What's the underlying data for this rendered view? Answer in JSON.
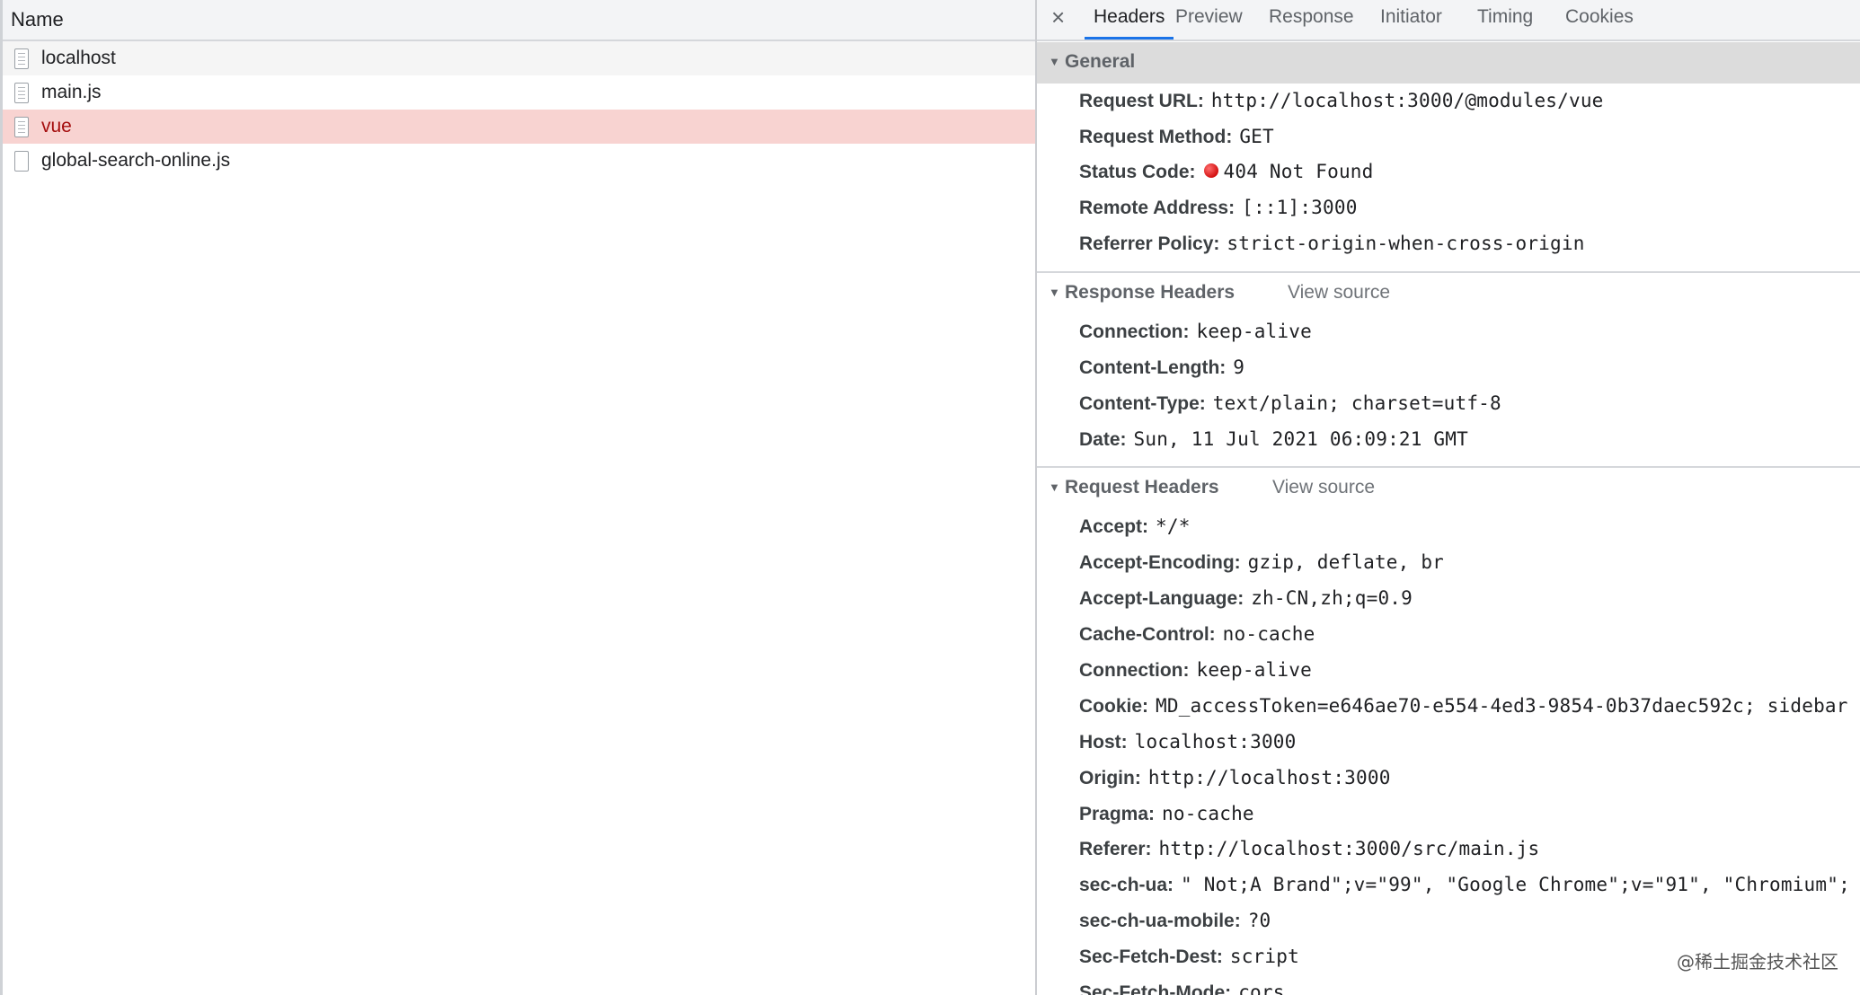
{
  "requests": {
    "column_name": "Name",
    "items": [
      {
        "name": "localhost",
        "icon": "document-icon"
      },
      {
        "name": "main.js",
        "icon": "document-icon"
      },
      {
        "name": "vue",
        "icon": "document-icon",
        "selected": true,
        "status_color": "#a50e0e"
      },
      {
        "name": "global-search-online.js",
        "icon": "blank-file-icon"
      }
    ]
  },
  "details": {
    "tabs": [
      "Headers",
      "Preview",
      "Response",
      "Initiator",
      "Timing",
      "Cookies"
    ],
    "active_tab": "Headers",
    "close_symbol": "×",
    "general": {
      "title": "General",
      "fields": [
        {
          "key": "Request URL:",
          "value": "http://localhost:3000/@modules/vue"
        },
        {
          "key": "Request Method:",
          "value": "GET"
        },
        {
          "key": "Status Code:",
          "value": "404 Not Found",
          "status_dot_color": "#d31010"
        },
        {
          "key": "Remote Address:",
          "value": "[::1]:3000"
        },
        {
          "key": "Referrer Policy:",
          "value": "strict-origin-when-cross-origin"
        }
      ]
    },
    "response_headers": {
      "title": "Response Headers",
      "view_source": "View source",
      "fields": [
        {
          "key": "Connection:",
          "value": "keep-alive"
        },
        {
          "key": "Content-Length:",
          "value": "9"
        },
        {
          "key": "Content-Type:",
          "value": "text/plain; charset=utf-8"
        },
        {
          "key": "Date:",
          "value": "Sun, 11 Jul 2021 06:09:21 GMT"
        }
      ]
    },
    "request_headers": {
      "title": "Request Headers",
      "view_source": "View source",
      "fields": [
        {
          "key": "Accept:",
          "value": "*/*"
        },
        {
          "key": "Accept-Encoding:",
          "value": "gzip, deflate, br"
        },
        {
          "key": "Accept-Language:",
          "value": "zh-CN,zh;q=0.9"
        },
        {
          "key": "Cache-Control:",
          "value": "no-cache"
        },
        {
          "key": "Connection:",
          "value": "keep-alive"
        },
        {
          "key": "Cookie:",
          "value": "MD_accessToken=e646ae70-e554-4ed3-9854-0b37daec592c; sidebar"
        },
        {
          "key": "Host:",
          "value": "localhost:3000"
        },
        {
          "key": "Origin:",
          "value": "http://localhost:3000"
        },
        {
          "key": "Pragma:",
          "value": "no-cache"
        },
        {
          "key": "Referer:",
          "value": "http://localhost:3000/src/main.js"
        },
        {
          "key": "sec-ch-ua:",
          "value": "\" Not;A Brand\";v=\"99\", \"Google Chrome\";v=\"91\", \"Chromium\";"
        },
        {
          "key": "sec-ch-ua-mobile:",
          "value": "?0"
        },
        {
          "key": "Sec-Fetch-Dest:",
          "value": "script"
        },
        {
          "key": "Sec-Fetch-Mode:",
          "value": "cors"
        }
      ]
    }
  },
  "watermark": "@稀土掘金技术社区",
  "colors": {
    "accent": "#1a73e8",
    "selected_row_bg": "#f8d3d1",
    "error_text": "#a50e0e"
  }
}
